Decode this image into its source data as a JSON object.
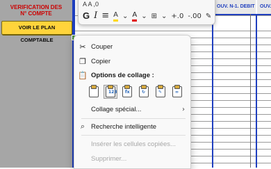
{
  "sheet": {
    "header_line1": "VERIFICATION DES",
    "header_line2": "N° COMPTE",
    "plan_button": "VOIR LE PLAN COMPTABLE",
    "col_header_1": "OUV. N-1. DEBIT",
    "col_header_2": "OUV."
  },
  "mini_toolbar": {
    "bold": "G",
    "italic": "I",
    "align": "≡",
    "fill": "A",
    "font_color": "A",
    "borders": "⊞",
    "dec_inc": "+.0",
    "dec_dec": "-.00",
    "painter": "✎",
    "top_partial": "A  A  ,0"
  },
  "menu": {
    "cut": "Couper",
    "copy": "Copier",
    "paste_options": "Options de collage :",
    "paste_special": "Collage spécial...",
    "smart_lookup": "Recherche intelligente",
    "insert_copied": "Insérer les cellules copiées...",
    "delete": "Supprimer..."
  },
  "colors": {
    "accent_blue": "#1f3fbf",
    "header_red": "#cc0000",
    "button_yellow": "#ffd43b",
    "gray_panel": "#a6a6a6"
  }
}
